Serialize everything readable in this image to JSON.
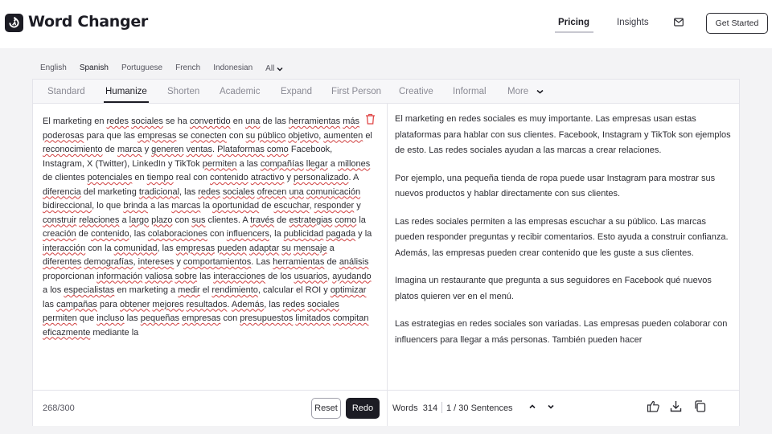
{
  "header": {
    "logo_text": "Word Changer",
    "nav": {
      "pricing": "Pricing",
      "insights": "Insights"
    },
    "get_started": "Get Started"
  },
  "languages": {
    "items": [
      "English",
      "Spanish",
      "Portuguese",
      "French",
      "Indonesian"
    ],
    "active": "Spanish",
    "all_label": "All"
  },
  "modes": {
    "items": [
      "Standard",
      "Humanize",
      "Shorten",
      "Academic",
      "Expand",
      "First Person",
      "Creative",
      "Informal"
    ],
    "active": "Humanize",
    "more_label": "More"
  },
  "input": {
    "text": "El marketing en redes sociales se ha convertido en una de las herramientas más poderosas para que las empresas se conecten con su público objetivo, aumenten el reconocimiento de marca y generen ventas. Plataformas como Facebook, Instagram, X (Twitter), LinkedIn y TikTok permiten a las compañías llegar a millones de clientes potenciales en tiempo real con contenido atractivo y personalizado. A diferencia del marketing tradicional, las redes sociales ofrecen una comunicación bidireccional, lo que brinda a las marcas la oportunidad de escuchar, responder y construir relaciones a largo plazo con sus clientes. A través de estrategias como la creación de contenido, las colaboraciones con influencers, la publicidad pagada y la interacción con la comunidad, las empresas pueden adaptar su mensaje a diferentes demografías, intereses y comportamientos. Las herramientas de análisis proporcionan información valiosa sobre las interacciones de los usuarios, ayudando a los especialistas en marketing a medir el rendimiento, calcular el ROI y optimizar las campañas para obtener mejores resultados. Además, las redes sociales permiten que incluso las pequeñas empresas con presupuestos limitados compitan eficazmente mediante la",
    "counter": "268/300",
    "reset": "Reset",
    "redo": "Redo"
  },
  "output": {
    "paragraphs": [
      "El marketing en redes sociales es muy importante. Las empresas usan estas plataformas para hablar con sus clientes. Facebook, Instagram y TikTok son ejemplos de esto. Las redes sociales ayudan a las marcas a crear relaciones.",
      "Por ejemplo, una pequeña tienda de ropa puede usar Instagram para mostrar sus nuevos productos y hablar directamente con sus clientes.",
      "Las redes sociales permiten a las empresas escuchar a su público. Las marcas pueden responder preguntas y recibir comentarios. Esto ayuda a construir confianza. Además, las empresas pueden crear contenido que les guste a sus clientes.",
      "Imagina un restaurante que pregunta a sus seguidores en Facebook qué nuevos platos quieren ver en el menú.",
      "Las estrategias en redes sociales son variadas. Las empresas pueden colaborar con influencers para llegar a más personas. También pueden hacer"
    ],
    "words_label": "Words",
    "words_count": "314",
    "sentences": "1 / 30 Sentences"
  },
  "icons": {
    "logo": "logo-icon",
    "mail": "mail-icon",
    "trash": "trash-icon",
    "like": "thumbs-up-icon",
    "download": "download-icon",
    "copy": "copy-icon"
  }
}
